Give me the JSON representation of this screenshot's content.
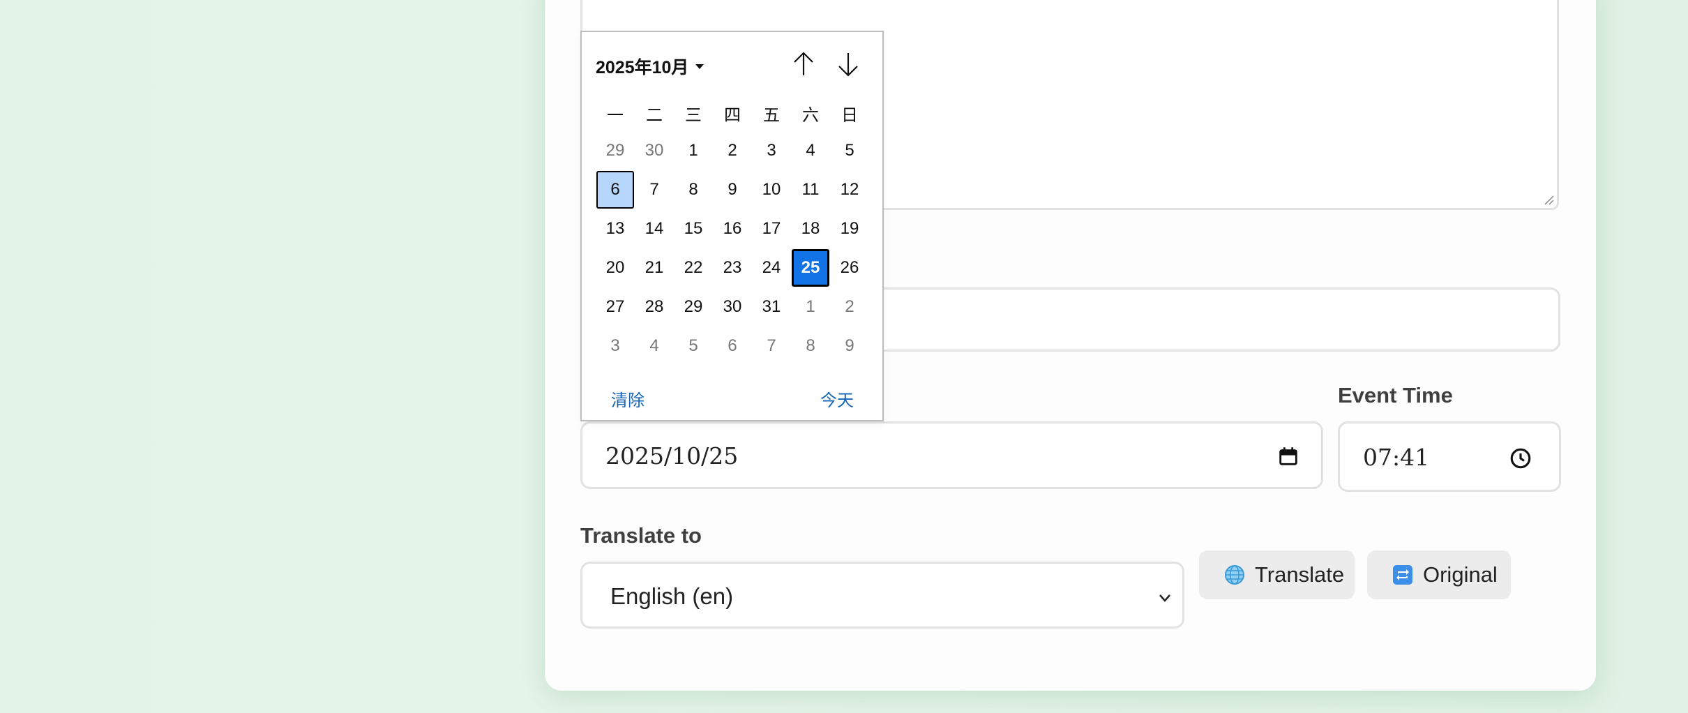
{
  "calendar": {
    "month_label": "2025年10月",
    "weekdays": [
      "一",
      "二",
      "三",
      "四",
      "五",
      "六",
      "日"
    ],
    "weeks": [
      [
        {
          "d": "29",
          "m": true
        },
        {
          "d": "30",
          "m": true
        },
        {
          "d": "1"
        },
        {
          "d": "2"
        },
        {
          "d": "3"
        },
        {
          "d": "4"
        },
        {
          "d": "5"
        }
      ],
      [
        {
          "d": "6",
          "today": true
        },
        {
          "d": "7"
        },
        {
          "d": "8"
        },
        {
          "d": "9"
        },
        {
          "d": "10"
        },
        {
          "d": "11"
        },
        {
          "d": "12"
        }
      ],
      [
        {
          "d": "13"
        },
        {
          "d": "14"
        },
        {
          "d": "15"
        },
        {
          "d": "16"
        },
        {
          "d": "17"
        },
        {
          "d": "18"
        },
        {
          "d": "19"
        }
      ],
      [
        {
          "d": "20"
        },
        {
          "d": "21"
        },
        {
          "d": "22"
        },
        {
          "d": "23"
        },
        {
          "d": "24"
        },
        {
          "d": "25",
          "selected": true
        },
        {
          "d": "26"
        }
      ],
      [
        {
          "d": "27"
        },
        {
          "d": "28"
        },
        {
          "d": "29"
        },
        {
          "d": "30"
        },
        {
          "d": "31"
        },
        {
          "d": "1",
          "m": true
        },
        {
          "d": "2",
          "m": true
        }
      ],
      [
        {
          "d": "3",
          "m": true
        },
        {
          "d": "4",
          "m": true
        },
        {
          "d": "5",
          "m": true
        },
        {
          "d": "6",
          "m": true
        },
        {
          "d": "7",
          "m": true
        },
        {
          "d": "8",
          "m": true
        },
        {
          "d": "9",
          "m": true
        }
      ]
    ],
    "clear_label": "清除",
    "today_label": "今天"
  },
  "form": {
    "event_time_label": "Event Time",
    "date_value": "2025/10/25",
    "time_value": "07:41",
    "translate_to_label": "Translate to",
    "language_value": "English (en)"
  },
  "buttons": {
    "translate_label": "Translate",
    "original_label": "Original"
  },
  "colors": {
    "accent": "#1273e6",
    "today_bg": "#b7d6fb",
    "link": "#1566b8"
  }
}
